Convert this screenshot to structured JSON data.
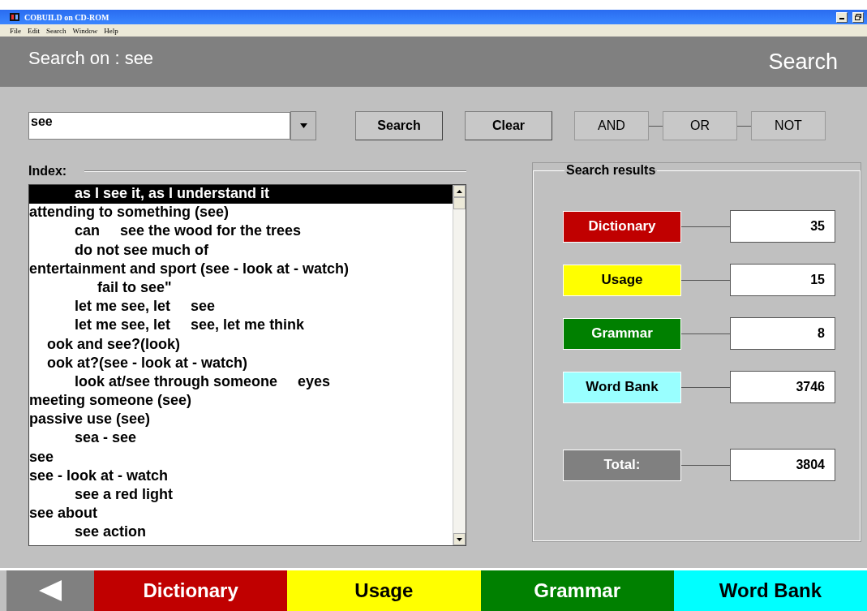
{
  "window": {
    "title": "COBUILD on CD-ROM"
  },
  "menu": [
    "File",
    "Edit",
    "Search",
    "Window",
    "Help"
  ],
  "header": {
    "title": "Search on : see",
    "mode": "Search"
  },
  "search": {
    "value": "see",
    "buttons": [
      "Search",
      "Clear"
    ],
    "operators": [
      "AND",
      "OR",
      "NOT"
    ]
  },
  "index": {
    "label": "Index:",
    "items": [
      {
        "text": "as I see it, as I understand it",
        "kind": "phrase",
        "selected": true
      },
      {
        "text": "attending to something (see)",
        "kind": "entry",
        "selected": false
      },
      {
        "text": "can     see the wood for the trees",
        "kind": "phrase",
        "selected": false
      },
      {
        "text": "do not see much of",
        "kind": "phrase",
        "selected": false
      },
      {
        "text": "entertainment and sport (see - look at - watch)",
        "kind": "entry",
        "selected": false
      },
      {
        "text": "fail to see\"",
        "kind": "deep",
        "selected": false
      },
      {
        "text": "let me see, let     see",
        "kind": "phrase",
        "selected": false
      },
      {
        "text": "let me see, let     see, let me think",
        "kind": "phrase",
        "selected": false
      },
      {
        "text": "ook and see?(look)",
        "kind": "fragment",
        "selected": false
      },
      {
        "text": "ook at?(see - look at - watch)",
        "kind": "fragment",
        "selected": false
      },
      {
        "text": "look at/see through someone     eyes",
        "kind": "phrase",
        "selected": false
      },
      {
        "text": "meeting someone (see)",
        "kind": "entry",
        "selected": false
      },
      {
        "text": "passive use (see)",
        "kind": "entry",
        "selected": false
      },
      {
        "text": "sea - see",
        "kind": "phrase",
        "selected": false
      },
      {
        "text": "see",
        "kind": "entry",
        "selected": false
      },
      {
        "text": "see - look at - watch",
        "kind": "entry",
        "selected": false
      },
      {
        "text": "see a red light",
        "kind": "phrase",
        "selected": false
      },
      {
        "text": "see about",
        "kind": "entry",
        "selected": false
      },
      {
        "text": "see action",
        "kind": "phrase",
        "selected": false
      }
    ]
  },
  "results": {
    "title": "Search results",
    "rows": [
      {
        "label": "Dictionary",
        "count": "35",
        "color": "#c00000"
      },
      {
        "label": "Usage",
        "count": "15",
        "color": "#ffff00"
      },
      {
        "label": "Grammar",
        "count": "8",
        "color": "#008000"
      },
      {
        "label": "Word Bank",
        "count": "3746",
        "color": "#99ffff"
      }
    ],
    "total": {
      "label": "Total:",
      "count": "3804"
    }
  },
  "tabs": [
    {
      "label": "Dictionary",
      "color": "#c00000"
    },
    {
      "label": "Usage",
      "color": "#ffff00"
    },
    {
      "label": "Grammar",
      "color": "#008000"
    },
    {
      "label": "Word Bank",
      "color": "#00ffff"
    }
  ]
}
